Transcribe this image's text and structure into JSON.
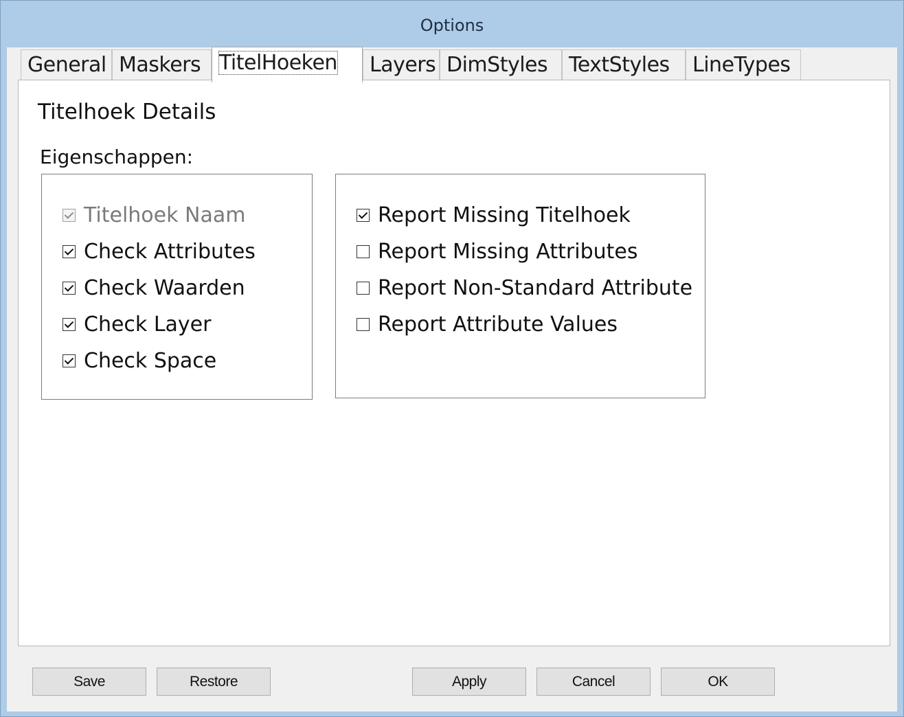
{
  "window": {
    "title": "Options"
  },
  "tabs": [
    {
      "label": "General"
    },
    {
      "label": "Maskers"
    },
    {
      "label": "TitelHoeken",
      "active": true
    },
    {
      "label": "Layers"
    },
    {
      "label": "DimStyles"
    },
    {
      "label": "TextStyles"
    },
    {
      "label": "LineTypes"
    }
  ],
  "panel": {
    "title": "Titelhoek Details",
    "section_label": "Eigenschappen:",
    "left_checks": [
      {
        "label": "Titelhoek Naam",
        "checked": true,
        "enabled": false
      },
      {
        "label": "Check Attributes",
        "checked": true,
        "enabled": true
      },
      {
        "label": "Check Waarden",
        "checked": true,
        "enabled": true
      },
      {
        "label": "Check Layer",
        "checked": true,
        "enabled": true
      },
      {
        "label": "Check Space",
        "checked": true,
        "enabled": true
      }
    ],
    "right_checks": [
      {
        "label": "Report Missing Titelhoek",
        "checked": true,
        "enabled": true
      },
      {
        "label": "Report Missing Attributes",
        "checked": false,
        "enabled": true
      },
      {
        "label": "Report Non-Standard Attribute",
        "checked": false,
        "enabled": true
      },
      {
        "label": "Report Attribute Values",
        "checked": false,
        "enabled": true
      }
    ]
  },
  "footer": {
    "save_label": "Save",
    "restore_label": "Restore",
    "apply_label": "Apply",
    "cancel_label": "Cancel",
    "ok_label": "OK"
  }
}
